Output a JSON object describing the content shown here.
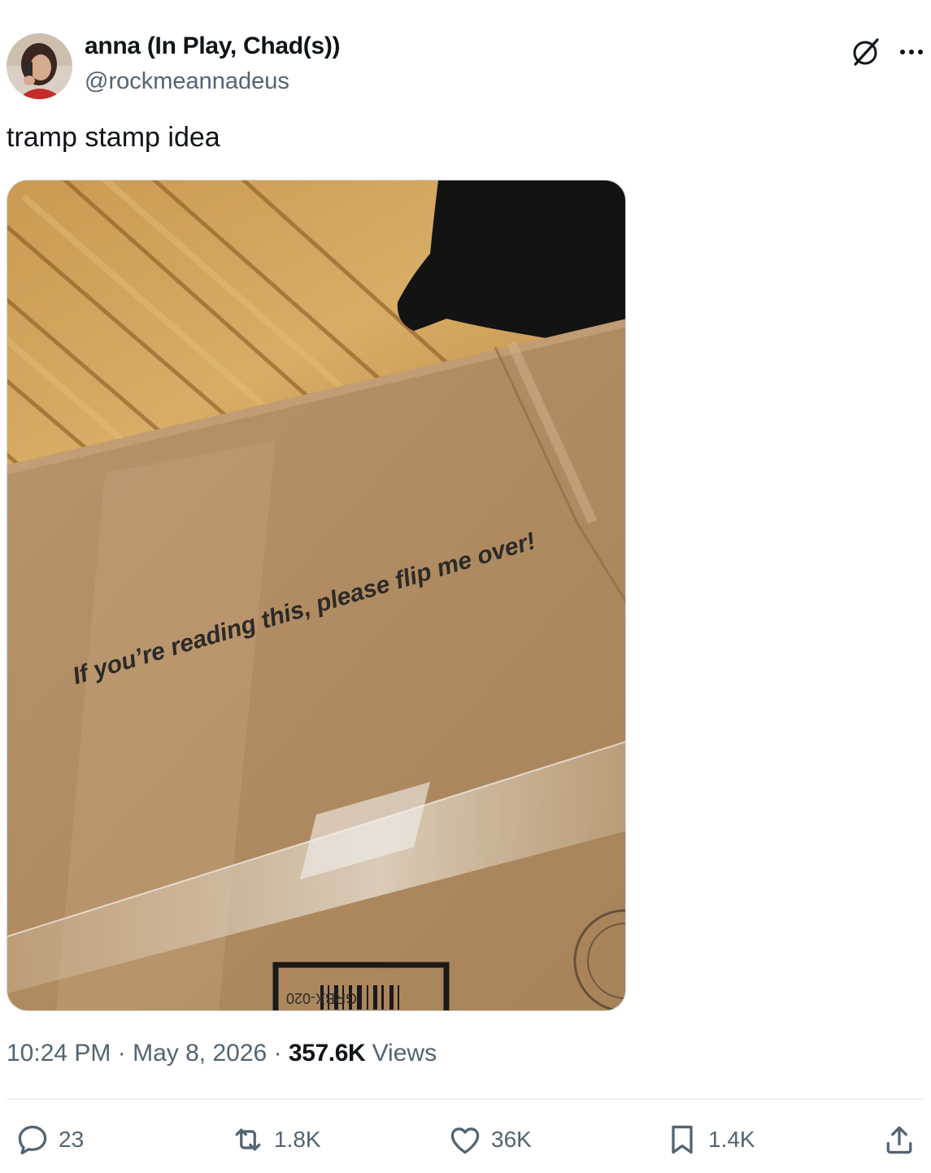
{
  "author": {
    "display_name": "anna (In Play, Chad(s))",
    "handle": "@rockmeannadeus"
  },
  "post": {
    "text": "tramp stamp idea",
    "media": {
      "box_message": "If you’re reading this, please flip me over!",
      "box_code": "GRBX-020"
    }
  },
  "meta": {
    "time": "10:24 PM",
    "separator": "·",
    "date": "May 8, 2026",
    "views_count": "357.6K",
    "views_label": "Views"
  },
  "actions": {
    "replies": "23",
    "reposts": "1.8K",
    "likes": "36K",
    "bookmarks": "1.4K"
  },
  "icons": [
    "grok-icon",
    "more-icon",
    "reply-icon",
    "repost-icon",
    "like-icon",
    "bookmark-icon",
    "share-icon"
  ],
  "colors": {
    "text_primary": "#0f1419",
    "text_secondary": "#536471",
    "divider": "#eff3f4"
  }
}
